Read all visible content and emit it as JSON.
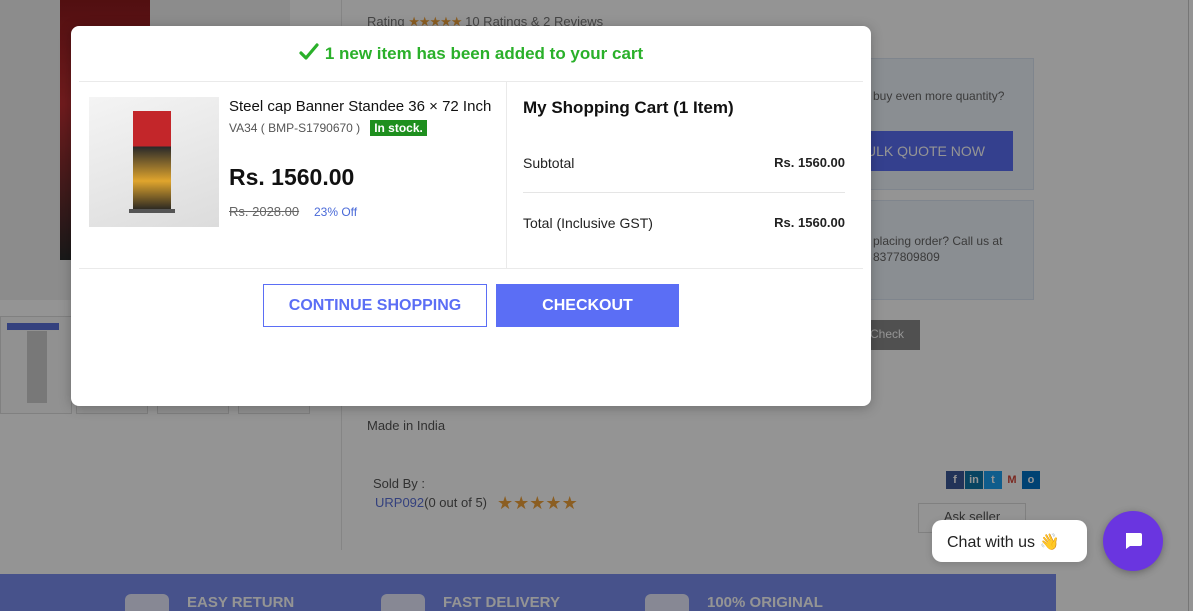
{
  "background": {
    "rating_label": "Rating",
    "rating_stars": "★★★★★",
    "rating_summary": "10 Ratings & 2 Reviews",
    "promo_question": "buy even more quantity?",
    "bulk_quote_label": "BULK QUOTE NOW",
    "call_text": "placing order? Call us at",
    "call_phone": "8377809809",
    "check_label": "Check",
    "made_in": "Made in India",
    "sold_by_label": "Sold By :",
    "seller_name": "URP092",
    "seller_rating": "(0 out of 5)",
    "seller_stars": "★★★★★",
    "ask_seller_label": "Ask seller",
    "footer": [
      "EASY RETURN",
      "FAST DELIVERY",
      "100% ORIGINAL"
    ]
  },
  "modal": {
    "header_message": "1 new item has been added to your cart",
    "product": {
      "name": "Steel cap Banner Standee 36 × 72 Inch",
      "sku": "VA34 ( BMP-S1790670 )",
      "stock": "In stock.",
      "price": "Rs. 1560.00",
      "old_price": "Rs. 2028.00",
      "discount": "23% Off"
    },
    "cart": {
      "title": "My Shopping Cart (1 Item)",
      "subtotal_label": "Subtotal",
      "subtotal_value": "Rs. 1560.00",
      "total_label": "Total (Inclusive GST)",
      "total_value": "Rs. 1560.00"
    },
    "continue_label": "CONTINUE SHOPPING",
    "checkout_label": "CHECKOUT"
  },
  "chat": {
    "label": "Chat with us 👋"
  },
  "colors": {
    "accent": "#5b6ef5",
    "success": "#2ab02a",
    "stock_badge": "#1e8f1e",
    "chat": "#6a35e0"
  }
}
